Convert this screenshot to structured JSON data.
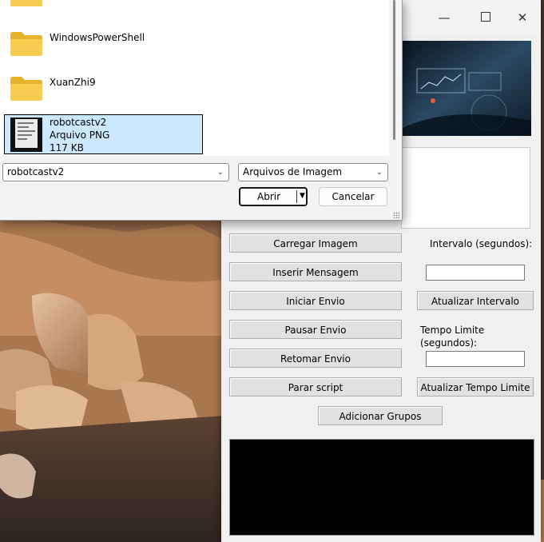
{
  "file_dialog": {
    "files": [
      {
        "name": "WindowsPowerShell",
        "icon": "folder-icon"
      },
      {
        "name": "XuanZhi9",
        "icon": "folder-icon"
      }
    ],
    "selected_file": {
      "name": "robotcastv2",
      "type": "Arquivo PNG",
      "size": "117 KB",
      "icon": "image-thumbnail"
    },
    "filename_value": "robotcastv2",
    "filetype_filter": "Arquivos de Imagem",
    "open_label": "Abrir",
    "cancel_label": "Cancelar"
  },
  "app": {
    "buttons": {
      "load_image": "Carregar Imagem",
      "insert_message": "Inserir Mensagem",
      "start_sending": "Iniciar Envio",
      "pause_sending": "Pausar Envio",
      "resume_sending": "Retomar Envio",
      "stop_script": "Parar script",
      "update_interval": "Atualizar Intervalo",
      "update_time_limit": "Atualizar Tempo Limite",
      "add_groups": "Adicionar Grupos"
    },
    "labels": {
      "interval": "Intervalo (segundos):",
      "time_limit": "Tempo Limite (segundos):"
    },
    "inputs": {
      "interval_value": "",
      "time_limit_value": ""
    }
  },
  "colors": {
    "selection_bg": "#cce8ff",
    "window_bg": "#f0f0f0",
    "console_bg": "#000000",
    "folder": "#f5c542"
  }
}
